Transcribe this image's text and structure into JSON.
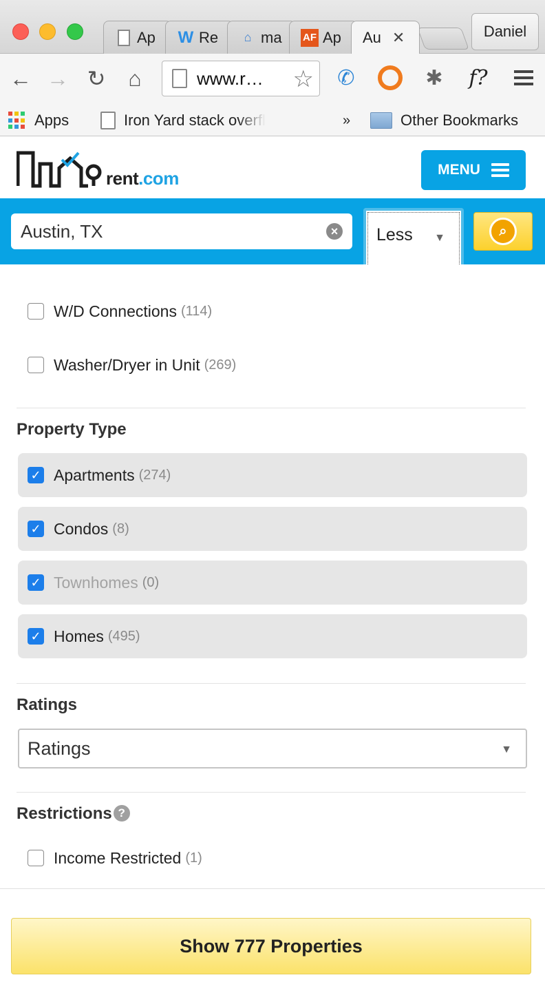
{
  "browser": {
    "tabs": [
      {
        "label": "Ap",
        "icon": "document-icon"
      },
      {
        "label": "Re",
        "icon": "weebly-icon"
      },
      {
        "label": "ma",
        "icon": "house-icon"
      },
      {
        "label": "Ap",
        "icon": "af-icon",
        "icon_text": "AF"
      },
      {
        "label": "Au",
        "icon": "none",
        "active": true
      }
    ],
    "profile_name": "Daniel",
    "url": "www.r…",
    "bookmarks": {
      "apps_label": "Apps",
      "item_label": "Iron Yard stack overfl",
      "overflow": "»",
      "other_label": "Other Bookmarks"
    },
    "extensions": [
      "chat-icon",
      "orange-ring-icon",
      "bug-icon",
      "f-question-icon"
    ],
    "ext_f_label": "f?"
  },
  "site": {
    "logo_text": "rent",
    "logo_suffix": ".com",
    "menu_label": "MENU",
    "accent": "#08a3e4"
  },
  "search": {
    "location": "Austin, TX",
    "more_toggle": "Less"
  },
  "filters": {
    "amenities": [
      {
        "label": "W/D Connections",
        "count": "(114)",
        "checked": false
      },
      {
        "label": "Washer/Dryer in Unit",
        "count": "(269)",
        "checked": false
      }
    ],
    "property_type_title": "Property Type",
    "property_types": [
      {
        "label": "Apartments",
        "count": "(274)",
        "checked": true
      },
      {
        "label": "Condos",
        "count": "(8)",
        "checked": true
      },
      {
        "label": "Townhomes",
        "count": "(0)",
        "checked": true,
        "disabled": true
      },
      {
        "label": "Homes",
        "count": "(495)",
        "checked": true
      }
    ],
    "ratings_title": "Ratings",
    "ratings_value": "Ratings",
    "restrictions_title": "Restrictions",
    "restrictions_help": "?",
    "restrictions": [
      {
        "label": "Income Restricted",
        "count": "(1)",
        "checked": false
      }
    ]
  },
  "footer": {
    "show_button": "Show 777 Properties"
  }
}
